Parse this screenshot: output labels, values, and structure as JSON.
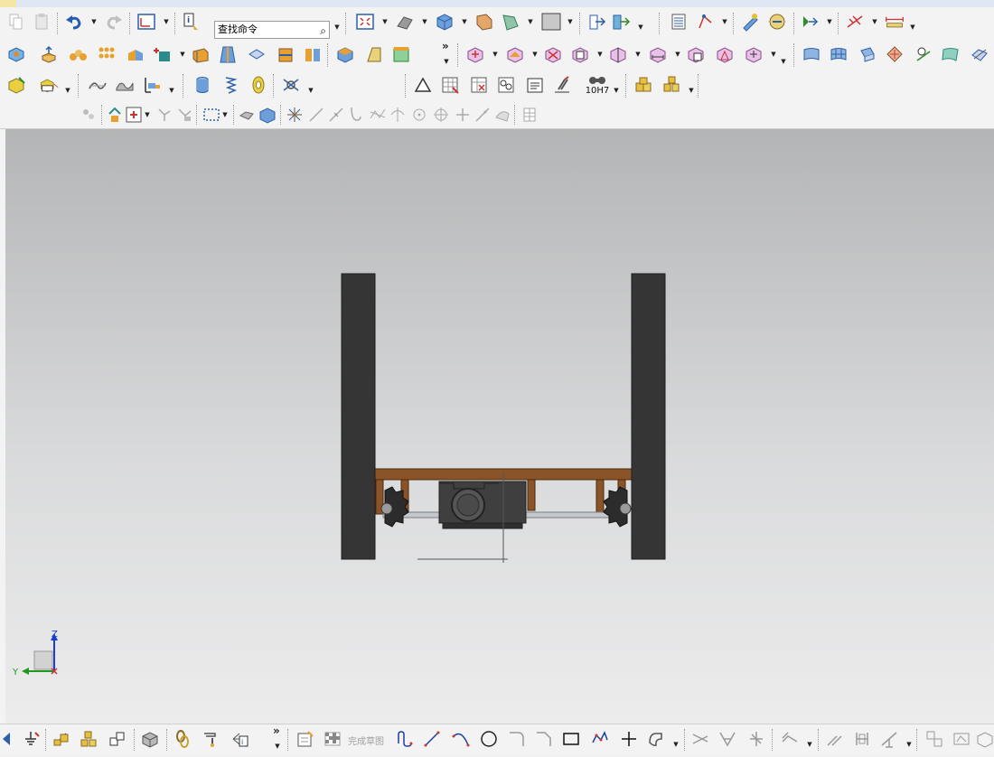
{
  "search": {
    "placeholder": "查找命令"
  },
  "toolbar3": {
    "tolerance_label": "10H7"
  },
  "bottombar": {
    "finish_sketch_label": "完成草图"
  },
  "axes": {
    "z_label": "Z",
    "y_label": "Y"
  },
  "colors": {
    "wheel": "#353535",
    "frame": "#8a5428",
    "gearbox": "#3f3f3f",
    "gear": "#2c2c2c",
    "axis_z": "#1a3fd6",
    "axis_y": "#1e9a1e",
    "axis_x": "#d03030"
  }
}
